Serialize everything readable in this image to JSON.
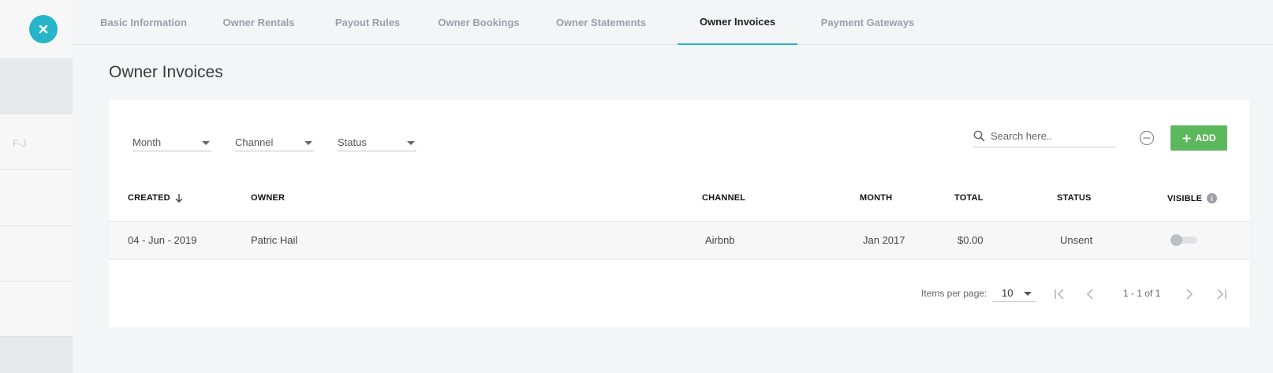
{
  "rail": {
    "label": "F-J"
  },
  "tabs": [
    {
      "label": "Basic Information"
    },
    {
      "label": "Owner Rentals"
    },
    {
      "label": "Payout Rules"
    },
    {
      "label": "Owner Bookings"
    },
    {
      "label": "Owner Statements"
    },
    {
      "label": "Owner Invoices",
      "active": true
    },
    {
      "label": "Payment Gateways"
    }
  ],
  "page_title": "Owner Invoices",
  "filters": {
    "month": "Month",
    "channel": "Channel",
    "status": "Status"
  },
  "search": {
    "placeholder": "Search here.."
  },
  "add_button": "ADD",
  "colors": {
    "accent": "#26b5c9",
    "add_green": "#5cb85c"
  },
  "table": {
    "columns": [
      "CREATED",
      "OWNER",
      "CHANNEL",
      "MONTH",
      "TOTAL",
      "STATUS",
      "VISIBLE"
    ],
    "rows": [
      {
        "created": "04 - Jun - 2019",
        "owner": "Patric Hail",
        "channel": "Airbnb",
        "month": "Jan 2017",
        "total": "$0.00",
        "status": "Unsent",
        "visible": false
      }
    ]
  },
  "pagination": {
    "items_per_page_label": "Items per page:",
    "items_per_page": "10",
    "range": "1 - 1 of 1"
  }
}
